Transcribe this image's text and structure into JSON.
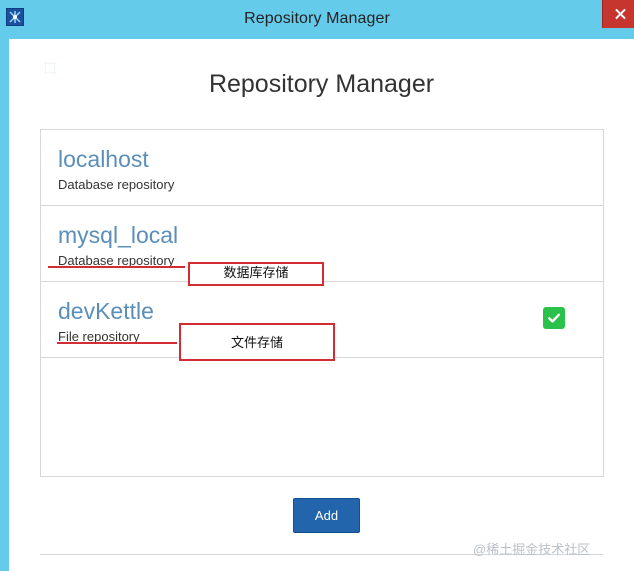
{
  "window": {
    "title": "Repository Manager",
    "accent_color": "#64cbeb",
    "close_icon": "close-icon"
  },
  "main": {
    "heading": "Repository Manager",
    "repositories": [
      {
        "name": "localhost",
        "type": "Database repository",
        "default": false
      },
      {
        "name": "mysql_local",
        "type": "Database repository",
        "default": false
      },
      {
        "name": "devKettle",
        "type": "File repository",
        "default": true
      }
    ],
    "add_label": "Add",
    "checkmark_color": "#2ac24a",
    "link_color": "#5b8fba",
    "button_color": "#2265ad"
  },
  "annotations": {
    "database_storage": "数据库存储",
    "file_storage": "文件存储",
    "color": "#d22d35"
  },
  "watermark": "@稀土掘金技术社区"
}
